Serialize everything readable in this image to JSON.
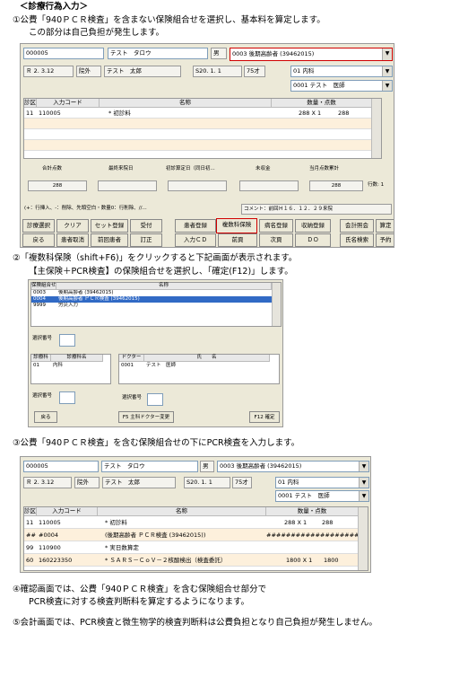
{
  "heading": "＜診療行為入力＞",
  "step1": {
    "line1": "①公費「940ＰＣＲ検査」を含まない保険組合せを選択し、基本料を算定します。",
    "line2": "この部分は自己負担が発生します。"
  },
  "s1": {
    "patient_no": "000005",
    "kana": "テスト　タロウ",
    "gender": "男",
    "insurance": "0003 後期高齢者 (39462015)",
    "date": "Ｒ 2. 3.12",
    "visit": "院外",
    "name": "テスト　太郎",
    "birth": "S20. 1. 1",
    "age": "75才",
    "dept": "01 内科",
    "doctor": "0001 テスト　医師",
    "cols": [
      "診区",
      "入力コード",
      "名称",
      "数量・点数"
    ],
    "rows": [
      {
        "ku": "11",
        "code": "110005",
        "name": "* 初診料",
        "qty": "288 X 1",
        "pts": "288"
      }
    ],
    "sum_labels": [
      "合計点数",
      "最終来院日",
      "初診算定日（同日初...",
      "未収金",
      "当月点数累計"
    ],
    "sum_values": [
      "288",
      "",
      "",
      "",
      "288"
    ],
    "rows_label": "行数:  1",
    "hint": "(+：行挿入、-：削除、先頭空白・数量0：行削除、//...",
    "comment": "コメント：前回Ｈ１６．１２．２９来院",
    "buttons_row1": [
      "診療選択",
      "クリア",
      "セット登録",
      "受付",
      "患者登録",
      "複数科保険",
      "病名登録",
      "収納登録",
      "会計照会",
      "算定"
    ],
    "buttons_row2": [
      "戻る",
      "患者取消",
      "前回患者",
      "訂正",
      "入力ＣＤ",
      "前頁",
      "次頁",
      "ＤＯ",
      "氏名検索",
      "予約"
    ]
  },
  "step2": {
    "line1": "②「複数科保険（shift+F6)」をクリックすると下記画面が表示されます。",
    "line2": "【主保険＋PCR検査】の保険組合せを選択し、「確定(F12)」します。"
  },
  "s2": {
    "col1": "保険組合せ",
    "col2": "名称",
    "rows": [
      {
        "code": "0003",
        "name": "後期高齢者 (39462015)"
      },
      {
        "code": "0004",
        "name": "後期高齢者 ＰＣＲ検査 (39462015)"
      },
      {
        "code": "9999",
        "name": "労災入力"
      }
    ],
    "sel_label": "選択番号",
    "dept_col1": "診療科",
    "dept_col2": "診療科名",
    "doc_col1": "ドクター",
    "doc_col2": "氏　　名",
    "dept_row": {
      "code": "01",
      "name": "内科"
    },
    "doc_row": {
      "code": "0001",
      "name": "テスト　医師"
    },
    "sel_label2": "選択番号",
    "sel_label3": "選択番号",
    "btn_back": "戻る",
    "btn_f5": "F5 主科ドクター変更",
    "btn_f12": "F12 確定"
  },
  "step3": {
    "line1": "③公費「940ＰＣＲ検査」を含む保険組合せの下にPCR検査を入力します。"
  },
  "s3": {
    "patient_no": "000005",
    "kana": "テスト　タロウ",
    "gender": "男",
    "insurance": "0003 後期高齢者 (39462015)",
    "date": "Ｒ 2. 3.12",
    "visit": "院外",
    "name": "テスト　太郎",
    "birth": "S20. 1. 1",
    "age": "75才",
    "dept": "01 内科",
    "doctor": "0001 テスト　医師",
    "cols": [
      "診区",
      "入力コード",
      "名称",
      "数量・点数"
    ],
    "rows": [
      {
        "ku": "11",
        "code": "110005",
        "name": "* 初診料",
        "qty": "288 X 1",
        "pts": "288"
      },
      {
        "ku": "##",
        "code": "#0004",
        "name": "(後期高齢者 ＰＣＲ検査 (39462015))",
        "qty": "########################",
        "pts": ""
      },
      {
        "ku": "99",
        "code": "110900",
        "name": "* 実日数算定",
        "qty": "",
        "pts": ""
      },
      {
        "ku": "60",
        "code": "160223350",
        "name": "* ＳＡＲＳ－ＣｏＶ－２核酸検出（検査委託）",
        "qty": "1800 X 1",
        "pts": "1800"
      }
    ]
  },
  "step4": {
    "line1": "④確認画面では、公費「940ＰＣＲ検査」を含む保険組合せ部分で",
    "line2": "PCR検査に対する検査判断料を算定するようになります。"
  },
  "step5": {
    "line1": "⑤会計画面では、PCR検査と微生物学的検査判断料は公費負担となり自己負担が発生しません。"
  },
  "colors": {
    "accent_red": "#d00000",
    "selected_row": "#316ac5",
    "shaded_row": "#fdf0dc",
    "panel_bg": "#ece9d8"
  }
}
